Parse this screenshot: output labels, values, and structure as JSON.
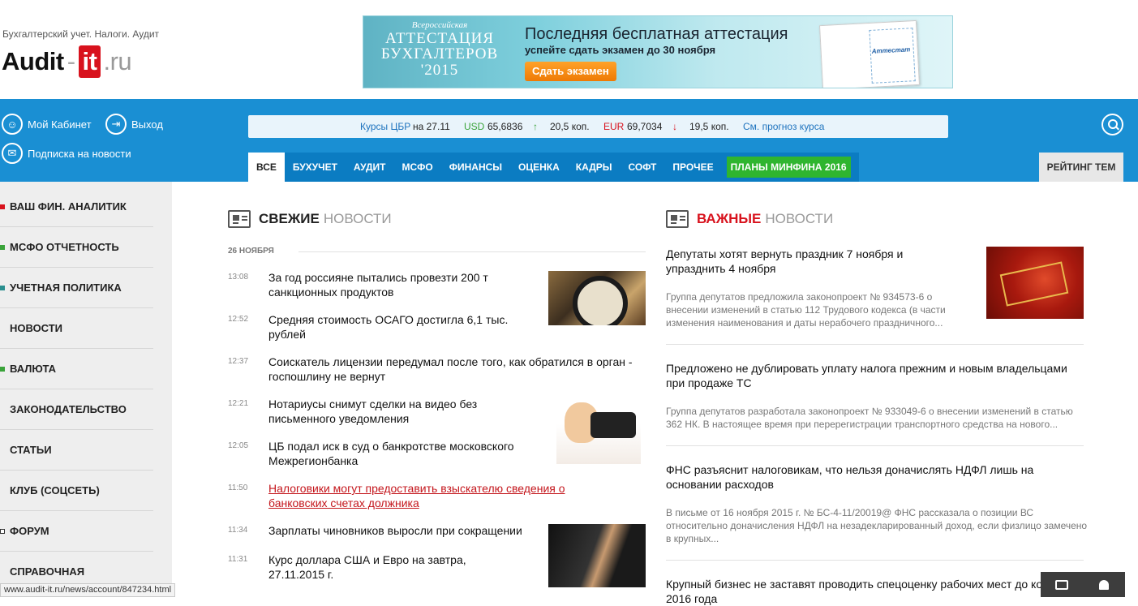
{
  "header": {
    "tagline": "Бухгалтерский учет. Налоги. Аудит",
    "logo": {
      "part1": "Audit",
      "sep": "-",
      "part2": "it",
      "part3": ".ru"
    },
    "banner": {
      "top_small": "Всероссийская",
      "line1": "АТТЕСТАЦИЯ",
      "line2": "БУХГАЛТЕРОВ",
      "line3": "'2015",
      "title": "Последняя бесплатная аттестация",
      "subtitle": "успейте сдать экзамен до 30 ноября",
      "button": "Сдать экзамен",
      "cert_label": "Аттестат"
    }
  },
  "user_links": {
    "cabinet": "Мой Кабинет",
    "logout": "Выход",
    "subscribe": "Подписка на новости"
  },
  "rates": {
    "label": "Курсы ЦБР",
    "date": "на 27.11",
    "usd_label": "USD",
    "usd_value": "65,6836",
    "usd_arrow": "↑",
    "usd_change": "20,5 коп.",
    "eur_label": "EUR",
    "eur_value": "69,7034",
    "eur_arrow": "↓",
    "eur_change": "19,5 коп.",
    "forecast": "См. прогноз курса"
  },
  "menu": [
    "ВСЕ",
    "БУХУЧЕТ",
    "АУДИТ",
    "МСФО",
    "ФИНАНСЫ",
    "ОЦЕНКА",
    "КАДРЫ",
    "СОФТ",
    "ПРОЧЕЕ"
  ],
  "menu_special": "ПЛАНЫ МИНФИНА 2016",
  "rating": "РЕЙТИНГ ТЕМ",
  "sidebar": [
    "ВАШ ФИН. АНАЛИТИК",
    "МСФО ОТЧЕТНОСТЬ",
    "УЧЕТНАЯ ПОЛИТИКА",
    "НОВОСТИ",
    "ВАЛЮТА",
    "ЗАКОНОДАТЕЛЬСТВО",
    "СТАТЬИ",
    "КЛУБ (СОЦСЕТЬ)",
    "ФОРУМ",
    "СПРАВОЧНАЯ"
  ],
  "fresh": {
    "w1": "СВЕЖИЕ",
    "w2": "НОВОСТИ",
    "date": "26 НОЯБРЯ",
    "items": [
      {
        "time": "13:08",
        "text": "За год россияне пытались провезти 200 т санкционных продуктов"
      },
      {
        "time": "12:52",
        "text": "Средняя стоимость ОСАГО достигла 6,1 тыс. рублей"
      },
      {
        "time": "12:37",
        "text": "Соискатель лицензии передумал после того, как обратился в орган - госпошлину не вернут"
      },
      {
        "time": "12:21",
        "text": "Нотариусы снимут сделки на видео без письменного уведомления"
      },
      {
        "time": "12:05",
        "text": "ЦБ подал иск в суд о банкротстве московского Межрегионбанка"
      },
      {
        "time": "11:50",
        "text": "Налоговики могут предоставить взыскателю сведения о банковских счетах должника"
      },
      {
        "time": "11:34",
        "text": "Зарплаты чиновников выросли при сокращении"
      },
      {
        "time": "11:31",
        "text": "Курс доллара США и Евро на завтра, 27.11.2015 г."
      }
    ]
  },
  "important": {
    "w1": "ВАЖНЫЕ",
    "w2": "НОВОСТИ",
    "items": [
      {
        "title": "Депутаты хотят вернуть праздник 7 ноября и упразднить 4 ноября",
        "desc": "Группа депутатов предложила законопроект № 934573-6 о внесении изменений в статью 112 Трудового кодекса (в части изменения наименования и даты нерабочего праздничного..."
      },
      {
        "title": "Предложено не дублировать уплату налога прежним и новым владельцами при продаже ТС",
        "desc": "Группа депутатов разработала законопроект № 933049-6 о внесении изменений в статью 362 НК. В настоящее время при перерегистрации транспортного средства на нового..."
      },
      {
        "title": "ФНС разъяснит налоговикам, что нельзя доначислять НДФЛ лишь на основании расходов",
        "desc": "В письме от 16 ноября 2015 г. № БС-4-11/20019@ ФНС рассказала о позиции ВС относительно доначисления НДФЛ на незадекларированный доход, если физлицо замечено в крупных..."
      },
      {
        "title": "Крупный бизнес не заставят проводить спецоценку рабочих мест до конца 2016 года",
        "desc": ""
      }
    ]
  },
  "status_url": "www.audit-it.ru/news/account/847234.html",
  "colors": {
    "brand_blue": "#1a8fd3",
    "brand_red": "#d8121d",
    "special_green": "#2fb52f"
  }
}
